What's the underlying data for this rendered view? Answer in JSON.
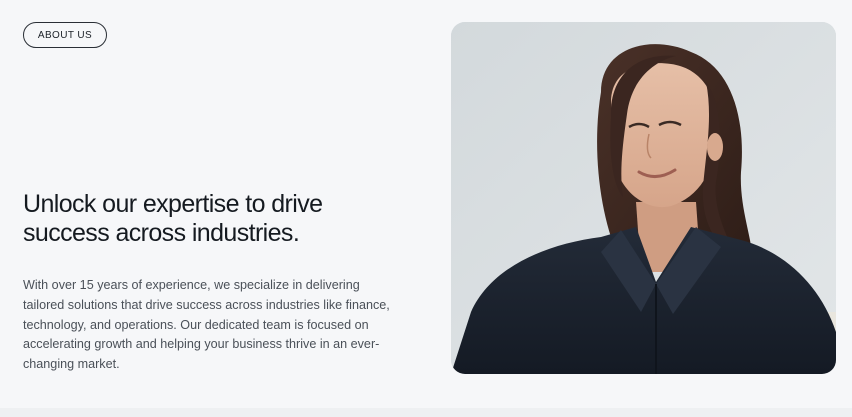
{
  "about": {
    "badge_label": "ABOUT US",
    "headline": "Unlock our expertise to drive success across industries.",
    "body": "With over 15 years of experience, we specialize in delivering tailored solutions that drive success across industries like finance, technology, and operations. Our dedicated team is focused on accelerating growth and helping your business thrive in an ever-changing market."
  },
  "colors": {
    "background": "#f6f7f9",
    "text_primary": "#151a20",
    "text_secondary": "#4a5058",
    "shirt": "#1f2633"
  },
  "photo": {
    "subject": "smiling woman in dark navy shirt"
  }
}
